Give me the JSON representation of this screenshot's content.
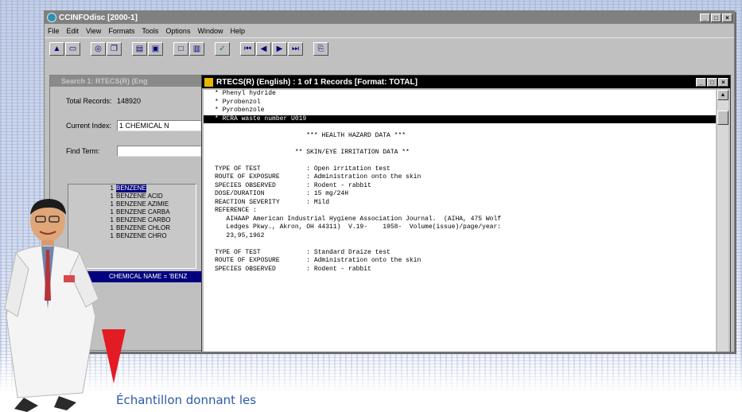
{
  "app": {
    "title": "CCINFOdisc [2000-1]",
    "menu": [
      "File",
      "Edit",
      "View",
      "Formats",
      "Tools",
      "Options",
      "Window",
      "Help"
    ]
  },
  "search_window": {
    "title": "Search 1: RTECS(R) (Eng",
    "total_records_label": "Total Records:",
    "total_records_value": "148920",
    "current_index_label": "Current Index:",
    "current_index_value": "1 CHEMICAL N",
    "find_term_label": "Find Term:",
    "find_term_value": "",
    "results": [
      {
        "count": "1",
        "name": "BENZENE",
        "selected": true
      },
      {
        "count": "1",
        "name": "BENZENE ACID",
        "selected": false
      },
      {
        "count": "1",
        "name": "BENZENE AZIMIE",
        "selected": false
      },
      {
        "count": "1",
        "name": "BENZENE CARBA",
        "selected": false
      },
      {
        "count": "1",
        "name": "BENZENE CARBO",
        "selected": false
      },
      {
        "count": "1",
        "name": "BENZENE CHLOR",
        "selected": false
      },
      {
        "count": "1",
        "name": "BENZENE CHRO",
        "selected": false
      }
    ],
    "status": "CHEMICAL NAME = 'BENZ"
  },
  "doc_window": {
    "title": "RTECS(R) (English) : 1 of 1 Records [Format: TOTAL]",
    "lines": [
      {
        "text": "* Phenyl hydride",
        "hl": false
      },
      {
        "text": "* Pyrobenzol",
        "hl": false
      },
      {
        "text": "* Pyrobenzole",
        "hl": false
      },
      {
        "text": "* RCRA waste number U019",
        "hl": true
      },
      {
        "text": "",
        "hl": false
      },
      {
        "text": "                        *** HEALTH HAZARD DATA ***",
        "hl": false
      },
      {
        "text": "",
        "hl": false
      },
      {
        "text": "                     ** SKIN/EYE IRRITATION DATA **",
        "hl": false
      },
      {
        "text": "",
        "hl": false
      },
      {
        "text": "TYPE OF TEST            : Open irritation test",
        "hl": false
      },
      {
        "text": "ROUTE OF EXPOSURE       : Administration onto the skin",
        "hl": false
      },
      {
        "text": "SPECIES OBSERVED        : Rodent - rabbit",
        "hl": false
      },
      {
        "text": "DOSE/DURATION           : 15 mg/24H",
        "hl": false
      },
      {
        "text": "REACTION SEVERITY       : Mild",
        "hl": false
      },
      {
        "text": "REFERENCE :",
        "hl": false
      },
      {
        "text": "   AIHAAP American Industrial Hygiene Association Journal.  (AIHA, 475 Wolf",
        "hl": false
      },
      {
        "text": "   Ledges Pkwy., Akron, OH 44311)  V.19-    1958-  Volume(issue)/page/year:",
        "hl": false
      },
      {
        "text": "   23,95,1962",
        "hl": false
      },
      {
        "text": "",
        "hl": false
      },
      {
        "text": "TYPE OF TEST            : Standard Draize test",
        "hl": false
      },
      {
        "text": "ROUTE OF EXPOSURE       : Administration onto the skin",
        "hl": false
      },
      {
        "text": "SPECIES OBSERVED        : Rodent - rabbit",
        "hl": false
      }
    ]
  },
  "caption": "Échantillon donnant les",
  "colors": {
    "pointer": "#e31b23",
    "caption": "#2a5aa8",
    "selection": "#000080"
  }
}
